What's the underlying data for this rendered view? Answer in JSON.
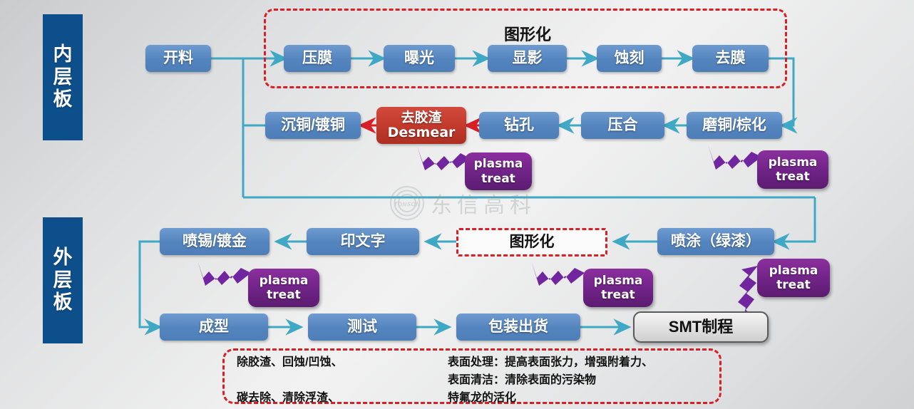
{
  "colors": {
    "box_blue": "#5585bf",
    "box_red": "#c0392b",
    "plasma_purple": "#6f2386",
    "band_blue": "#0d4f8b",
    "dash_red": "#d81f26",
    "wire_teal": "#3fa8c4",
    "bolt_purple": "#7126a0"
  },
  "bands": [
    {
      "id": "inner",
      "label": "内层板"
    },
    {
      "id": "outer",
      "label": "外层板"
    }
  ],
  "groups": [
    {
      "id": "inner-pattern",
      "title": "图形化"
    }
  ],
  "rows": {
    "row1": [
      {
        "id": "kailiao",
        "label": "开料",
        "style": "blue"
      },
      {
        "id": "yamo",
        "label": "压膜",
        "style": "blue"
      },
      {
        "id": "baoguang",
        "label": "曝光",
        "style": "blue"
      },
      {
        "id": "xianying",
        "label": "显影",
        "style": "blue"
      },
      {
        "id": "shike",
        "label": "蚀刻",
        "style": "blue"
      },
      {
        "id": "qumo",
        "label": "去膜",
        "style": "blue"
      }
    ],
    "row2": [
      {
        "id": "chentong",
        "label": "沉铜/镀铜",
        "style": "blue"
      },
      {
        "id": "qujiaozha",
        "label_line1": "去胶渣",
        "label_line2": "Desmear",
        "style": "red"
      },
      {
        "id": "zuankong",
        "label": "钻孔",
        "style": "blue"
      },
      {
        "id": "yahe",
        "label": "压合",
        "style": "blue"
      },
      {
        "id": "motong",
        "label": "磨铜/棕化",
        "style": "blue"
      }
    ],
    "row3": [
      {
        "id": "pentixi",
        "label": "喷锡/镀金",
        "style": "blue"
      },
      {
        "id": "yinwenzi",
        "label": "印文字",
        "style": "blue"
      },
      {
        "id": "tuxinghua2",
        "label": "图形化",
        "style": "white-dash"
      },
      {
        "id": "pentu",
        "label": "喷涂（绿漆）",
        "style": "blue"
      }
    ],
    "row4": [
      {
        "id": "chengxing",
        "label": "成型",
        "style": "blue"
      },
      {
        "id": "ceshi",
        "label": "测试",
        "style": "blue"
      },
      {
        "id": "baozhuang",
        "label": "包装出货",
        "style": "blue"
      },
      {
        "id": "smt",
        "label": "SMT制程",
        "style": "gray"
      }
    ]
  },
  "plasma_tags": [
    {
      "id": "plasma-desmear",
      "line1": "plasma",
      "line2": "treat"
    },
    {
      "id": "plasma-motong",
      "line1": "plasma",
      "line2": "treat"
    },
    {
      "id": "plasma-pentixi",
      "line1": "plasma",
      "line2": "treat"
    },
    {
      "id": "plasma-tuxinghua",
      "line1": "plasma",
      "line2": "treat"
    },
    {
      "id": "plasma-smt",
      "line1": "plasma",
      "line2": "treat"
    }
  ],
  "legend": {
    "left": "除胶渣、回蚀/凹蚀、\n\n碳去除、清除浮渣、",
    "right": "表面处理：提高表面张力，增强附着力、\n表面清洁：清除表面的污染物\n特氟龙的活化"
  },
  "watermark": {
    "mark": "TONSON",
    "text": "东信高科"
  }
}
